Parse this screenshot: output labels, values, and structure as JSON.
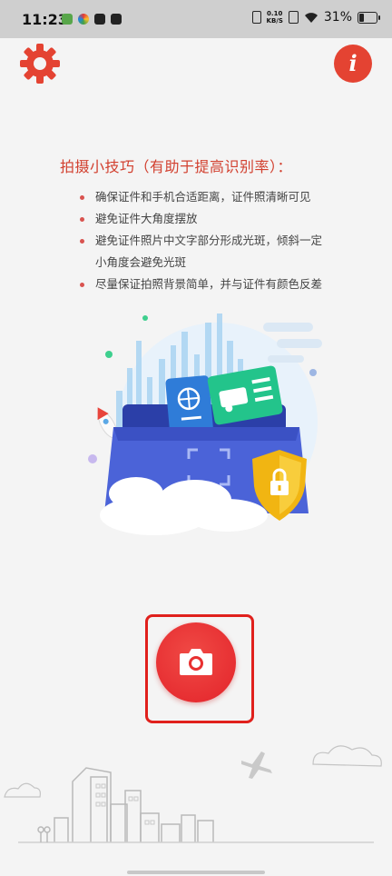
{
  "status_bar": {
    "time": "11:23",
    "net_speed_value": "0.10",
    "net_speed_unit": "KB/S",
    "battery_text": "31%",
    "battery_level": 0.31
  },
  "header": {
    "settings_icon": "gear-icon",
    "info_icon": "info-icon",
    "info_glyph": "i"
  },
  "tips": {
    "title": "拍摄小技巧（有助于提高识别率）：",
    "items": [
      "确保证件和手机合适距离，证件照清晰可见",
      "避免证件大角度摆放",
      "避免证件照片中文字部分形成光斑，倾斜一定",
      "小角度会避免光斑",
      "尽量保证拍照背景简单，并与证件有颜色反差"
    ]
  },
  "camera": {
    "icon": "camera-icon"
  },
  "colors": {
    "accent": "#e44332",
    "frame": "#e0201c",
    "background": "#f4f4f4"
  }
}
